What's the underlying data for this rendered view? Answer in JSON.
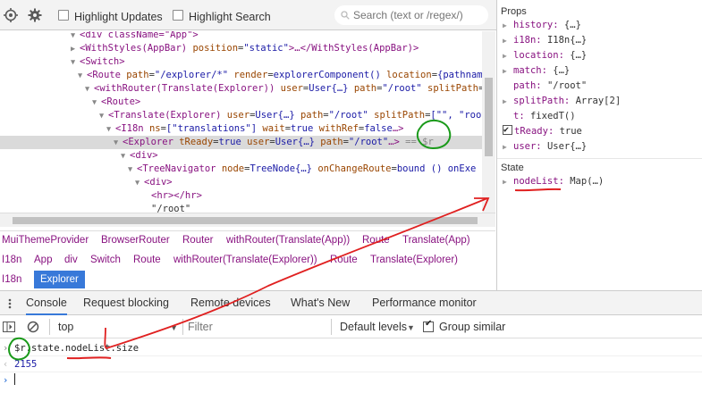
{
  "toolbar": {
    "highlight_updates_label": "Highlight Updates",
    "highlight_search_label": "Highlight Search",
    "search_placeholder": "Search (text or /regex/)"
  },
  "tree": {
    "lines": [
      {
        "frag": [
          [
            "tag",
            "<div className=\"App\">"
          ]
        ],
        "depth": 9,
        "arrow": "▼"
      },
      {
        "frag": [
          [
            "tag",
            "<WithStyles(AppBar) "
          ],
          [
            "attr",
            "position"
          ],
          [
            "plain",
            "="
          ],
          [
            "val",
            "\"static\""
          ],
          [
            "tag",
            ">…</WithStyles(AppBar)>"
          ]
        ],
        "depth": 9,
        "arrow": "▶"
      },
      {
        "frag": [
          [
            "tag",
            "<Switch>"
          ]
        ],
        "depth": 9,
        "arrow": "▼"
      },
      {
        "frag": [
          [
            "tag",
            "<Route "
          ],
          [
            "attr",
            "path"
          ],
          [
            "plain",
            "="
          ],
          [
            "val",
            "\"/explorer/*\""
          ],
          [
            "attr",
            " render"
          ],
          [
            "plain",
            "="
          ],
          [
            "val",
            "explorerComponent()"
          ],
          [
            "attr",
            " location"
          ],
          [
            "plain",
            "="
          ],
          [
            "val",
            "{pathname:"
          ]
        ],
        "depth": 10,
        "arrow": "▼"
      },
      {
        "frag": [
          [
            "tag",
            "<withRouter(Translate(Explorer)) "
          ],
          [
            "attr",
            "user"
          ],
          [
            "plain",
            "="
          ],
          [
            "val",
            "User{…}"
          ],
          [
            "attr",
            " path"
          ],
          [
            "plain",
            "="
          ],
          [
            "val",
            "\"/root\""
          ],
          [
            "attr",
            " splitPath"
          ],
          [
            "plain",
            "="
          ],
          [
            "val",
            "["
          ]
        ],
        "depth": 11,
        "arrow": "▼"
      },
      {
        "frag": [
          [
            "tag",
            "<Route>"
          ]
        ],
        "depth": 12,
        "arrow": "▼"
      },
      {
        "frag": [
          [
            "tag",
            "<Translate(Explorer) "
          ],
          [
            "attr",
            "user"
          ],
          [
            "plain",
            "="
          ],
          [
            "val",
            "User{…}"
          ],
          [
            "attr",
            " path"
          ],
          [
            "plain",
            "="
          ],
          [
            "val",
            "\"/root\""
          ],
          [
            "attr",
            " splitPath"
          ],
          [
            "plain",
            "="
          ],
          [
            "val",
            "[\"\", \"root"
          ]
        ],
        "depth": 13,
        "arrow": "▼"
      },
      {
        "frag": [
          [
            "tag",
            "<I18n "
          ],
          [
            "attr",
            "ns"
          ],
          [
            "plain",
            "="
          ],
          [
            "val",
            "[\"translations\"]"
          ],
          [
            "attr",
            " wait"
          ],
          [
            "plain",
            "="
          ],
          [
            "val",
            "true"
          ],
          [
            "attr",
            " withRef"
          ],
          [
            "plain",
            "="
          ],
          [
            "val",
            "false"
          ],
          [
            "tag",
            "…>"
          ]
        ],
        "depth": 14,
        "arrow": "▼"
      },
      {
        "frag": [
          [
            "tag",
            "<Explorer "
          ],
          [
            "attr",
            "tReady"
          ],
          [
            "plain",
            "="
          ],
          [
            "val",
            "true"
          ],
          [
            "attr",
            " user"
          ],
          [
            "plain",
            "="
          ],
          [
            "val",
            "User{…}"
          ],
          [
            "attr",
            " path"
          ],
          [
            "plain",
            "="
          ],
          [
            "val",
            "\"/root\""
          ],
          [
            "tag",
            "…>"
          ],
          [
            "eq",
            " == $r"
          ]
        ],
        "depth": 15,
        "arrow": "▼",
        "selected": true
      },
      {
        "frag": [
          [
            "tag",
            "<div>"
          ]
        ],
        "depth": 16,
        "arrow": "▼"
      },
      {
        "frag": [
          [
            "tag",
            "<TreeNavigator "
          ],
          [
            "attr",
            "node"
          ],
          [
            "plain",
            "="
          ],
          [
            "val",
            "TreeNode{…}"
          ],
          [
            "attr",
            " onChangeRoute"
          ],
          [
            "plain",
            "="
          ],
          [
            "val",
            "bound () onExe"
          ]
        ],
        "depth": 17,
        "arrow": "▼"
      },
      {
        "frag": [
          [
            "tag",
            "<div>"
          ]
        ],
        "depth": 18,
        "arrow": "▼"
      },
      {
        "frag": [
          [
            "tag",
            "<hr></hr>"
          ]
        ],
        "depth": 19,
        "arrow": ""
      },
      {
        "frag": [
          [
            "plain",
            "\"/root\""
          ]
        ],
        "depth": 19,
        "arrow": ""
      }
    ]
  },
  "breadcrumb": {
    "row1": [
      "MuiThemeProvider",
      "BrowserRouter",
      "Router",
      "withRouter(Translate(App))",
      "Route",
      "Translate(App)"
    ],
    "row2": [
      "I18n",
      "App",
      "div",
      "Switch",
      "Route",
      "withRouter(Translate(Explorer))",
      "Route",
      "Translate(Explorer)"
    ],
    "row3": [
      "I18n",
      "Explorer"
    ]
  },
  "props": {
    "title": "Props",
    "items": [
      {
        "key": "history",
        "value": "{…}",
        "tri": true
      },
      {
        "key": "i18n",
        "value": "I18n{…}",
        "tri": true
      },
      {
        "key": "location",
        "value": "{…}",
        "tri": true
      },
      {
        "key": "match",
        "value": "{…}",
        "tri": true
      },
      {
        "key": "path",
        "value": "\"/root\"",
        "tri": false
      },
      {
        "key": "splitPath",
        "value": "Array[2]",
        "tri": true
      },
      {
        "key": "t",
        "value": "fixedT()",
        "tri": false
      },
      {
        "key": "tReady",
        "value": "true",
        "tri": false,
        "checkbox": true
      },
      {
        "key": "user",
        "value": "User{…}",
        "tri": true
      }
    ]
  },
  "state": {
    "title": "State",
    "items": [
      {
        "key": "nodeList",
        "value": "Map(…)",
        "tri": true
      }
    ]
  },
  "drawer": {
    "tabs": [
      "Console",
      "Request blocking",
      "Remote devices",
      "What's New",
      "Performance monitor"
    ],
    "active_tab": "Console"
  },
  "console_toolbar": {
    "context": "top",
    "filter_placeholder": "Filter",
    "levels": "Default levels",
    "group_similar": "Group similar"
  },
  "console": {
    "input_line": "$r.state.nodeList.size",
    "output": "2155"
  },
  "colors": {
    "accent": "#3879d9",
    "annotation_red": "#e02020",
    "annotation_green": "#1a9a1a"
  }
}
